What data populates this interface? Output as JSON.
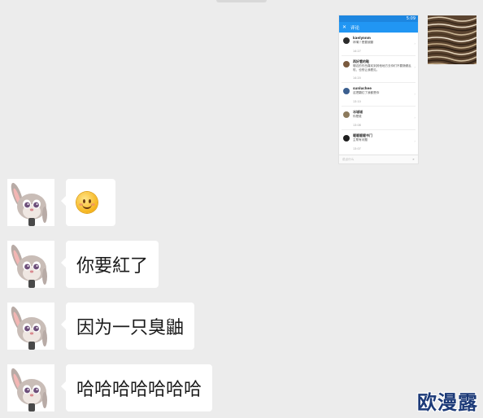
{
  "shared_screenshot": {
    "status_time": "5:09",
    "title": "评论",
    "close_icon": "close-icon",
    "comments": [
      {
        "name": "kaelynnm",
        "text": "林嘴丫是要被翻",
        "date": "14:27",
        "avatar_color": "#2b2b2b"
      },
      {
        "name": "再好看的鞋",
        "text": "哪边的东西喜欢到其他地方去你们不要随便乱咬，也别让我看见。",
        "date": "14:20",
        "avatar_color": "#7a5a3e"
      },
      {
        "name": "sunluchee",
        "text": "这把翻红了我都是你",
        "date": "13:10",
        "avatar_color": "#3b5f8f"
      },
      {
        "name": "冰城城",
        "text": "你是谁",
        "date": "13:08",
        "avatar_color": "#8c7a5c"
      },
      {
        "name": "暖暖暖暖书门",
        "text": "主帮有问题",
        "date": "13:07",
        "avatar_color": "#1f1f1f"
      }
    ],
    "input_placeholder": "说点什么",
    "send_icon": "send-icon"
  },
  "messages": [
    {
      "type": "emoji",
      "emoji_name": "smiling-face-emoji"
    },
    {
      "type": "text",
      "text": "你要紅了"
    },
    {
      "type": "text",
      "text": "因为一只臭鼬"
    },
    {
      "type": "text",
      "text": "哈哈哈哈哈哈哈"
    }
  ],
  "watermark": "欧漫露",
  "colors": {
    "background": "#ececec",
    "bubble": "#ffffff",
    "app_bar": "#2196f3",
    "watermark": "#1c3a78"
  }
}
